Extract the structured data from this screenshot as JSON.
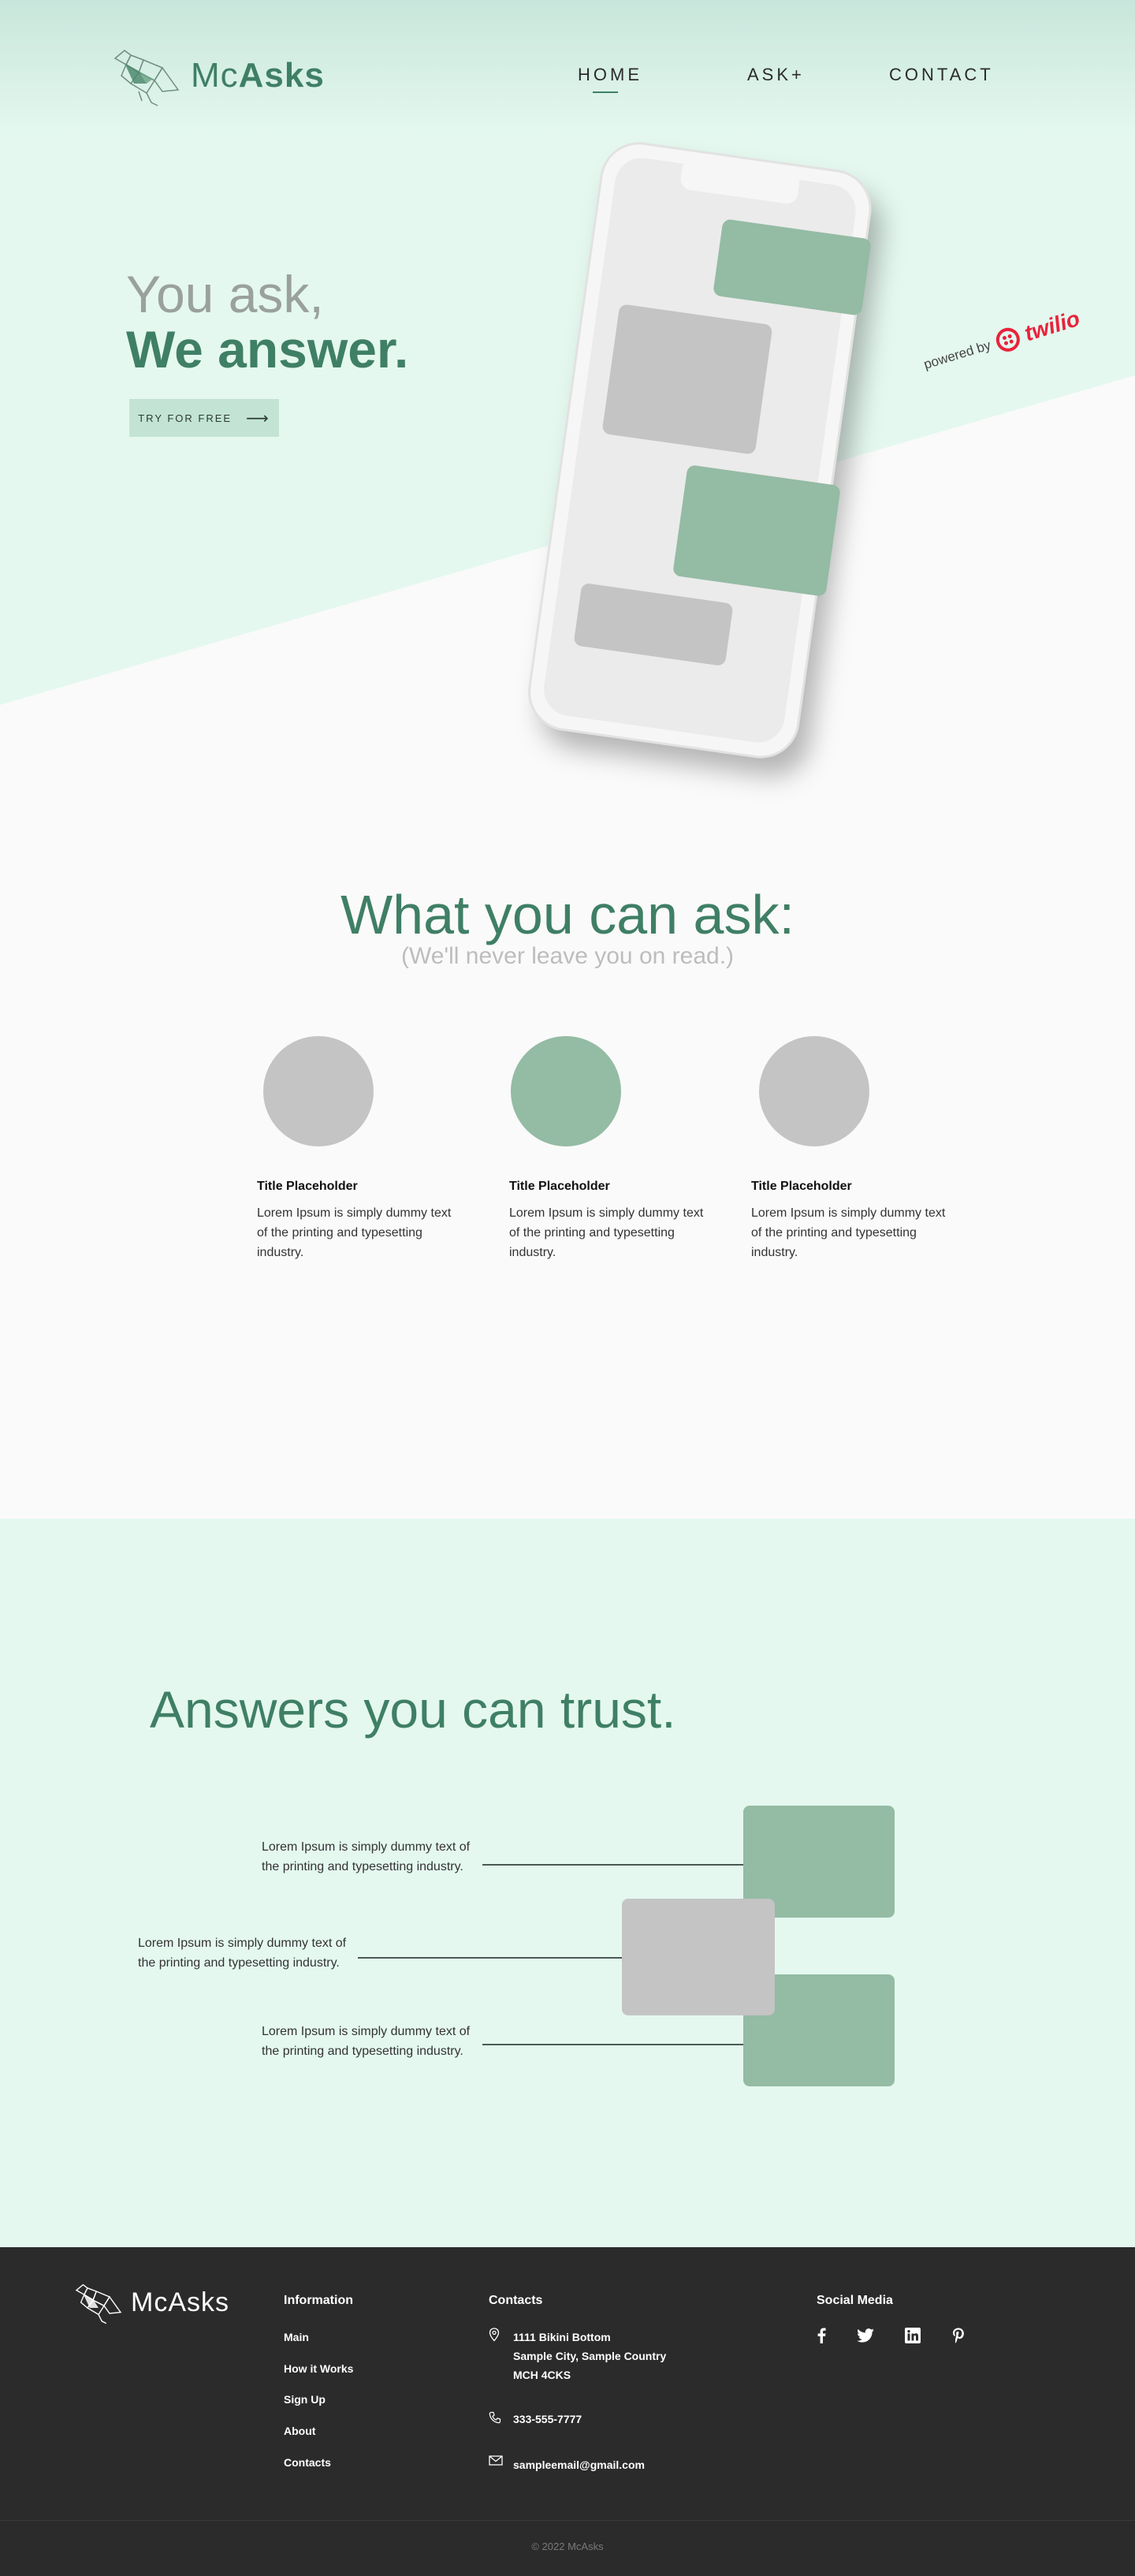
{
  "brand": {
    "name_light": "Mc",
    "name_bold": "Asks"
  },
  "nav": {
    "home": "HOME",
    "ask": "ASK+",
    "contact": "CONTACT"
  },
  "hero": {
    "line1": "You ask,",
    "line2": "We answer.",
    "cta": "TRY FOR FREE",
    "cta_arrow": "⟶",
    "powered_by": "powered by",
    "partner": "twilio"
  },
  "ask": {
    "title": "What you can ask:",
    "subtitle": "(We'll never leave you on read.)",
    "features": [
      {
        "title": "Title Placeholder",
        "text": "Lorem Ipsum is simply dummy text of the printing and typesetting industry."
      },
      {
        "title": "Title Placeholder",
        "text": "Lorem Ipsum is simply dummy text of the printing and typesetting industry."
      },
      {
        "title": "Title Placeholder",
        "text": "Lorem Ipsum is simply dummy text of the printing and typesetting industry."
      }
    ]
  },
  "trust": {
    "title": "Answers you can trust.",
    "items": [
      "Lorem Ipsum is simply dummy text of the printing and typesetting industry.",
      "Lorem Ipsum is simply dummy text of the printing and typesetting industry.",
      "Lorem Ipsum is simply dummy text of the printing and typesetting industry."
    ]
  },
  "footer": {
    "information": {
      "title": "Information",
      "links": [
        "Main",
        "How it Works",
        "Sign Up",
        "About",
        "Contacts"
      ]
    },
    "contacts": {
      "title": "Contacts",
      "address": [
        "1111 Bikini Bottom",
        "Sample City, Sample Country",
        "MCH 4CKS"
      ],
      "phone": "333-555-7777",
      "email": "sampleemail@gmail.com"
    },
    "social": {
      "title": "Social Media",
      "icons": [
        "facebook-icon",
        "twitter-icon",
        "linkedin-icon",
        "pinterest-icon"
      ]
    },
    "copyright": "© 2022 McAsks"
  },
  "colors": {
    "mint_bg": "#e4f8ef",
    "brand_green": "#3f7f66",
    "sage": "#94bba4",
    "gray_placeholder": "#c4c4c4",
    "footer_bg": "#2b2b2b",
    "twilio_red": "#e8233b"
  }
}
